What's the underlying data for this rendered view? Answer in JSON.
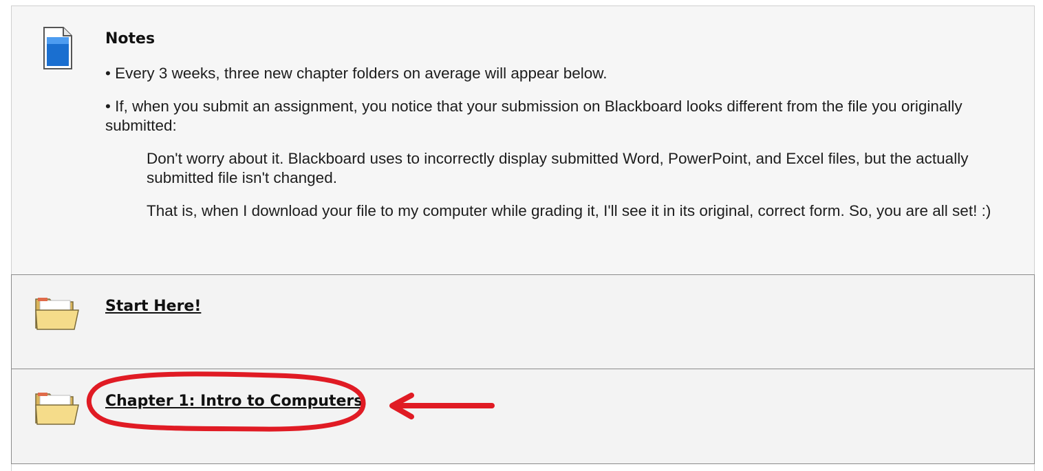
{
  "notes": {
    "title": "Notes",
    "icon": "document-icon",
    "paragraphs": [
      "• Every 3 weeks, three new chapter folders on average will appear below.",
      "• If, when you submit an assignment, you notice that your submission on Blackboard looks different from the file you originally submitted:"
    ],
    "indented": [
      "Don't worry about it. Blackboard uses to incorrectly display submitted Word, PowerPoint, and Excel files, but the actually submitted file isn't changed.",
      "That is, when I download your file to my computer while grading it, I'll see it in its original, correct form. So, you are all set! :)"
    ]
  },
  "folders": [
    {
      "label": "Start Here!",
      "icon": "folder-icon"
    },
    {
      "label": "Chapter 1: Intro to Computers",
      "icon": "folder-icon"
    }
  ],
  "annotation": {
    "color": "#e01b24",
    "shapes": [
      "circle-highlight",
      "arrow-left"
    ]
  },
  "colors": {
    "panel_bg": "#f4f4f4",
    "border": "#8a8a8a",
    "doc_icon_blue": "#1a6fd0",
    "folder_yellow": "#f3d77a"
  }
}
